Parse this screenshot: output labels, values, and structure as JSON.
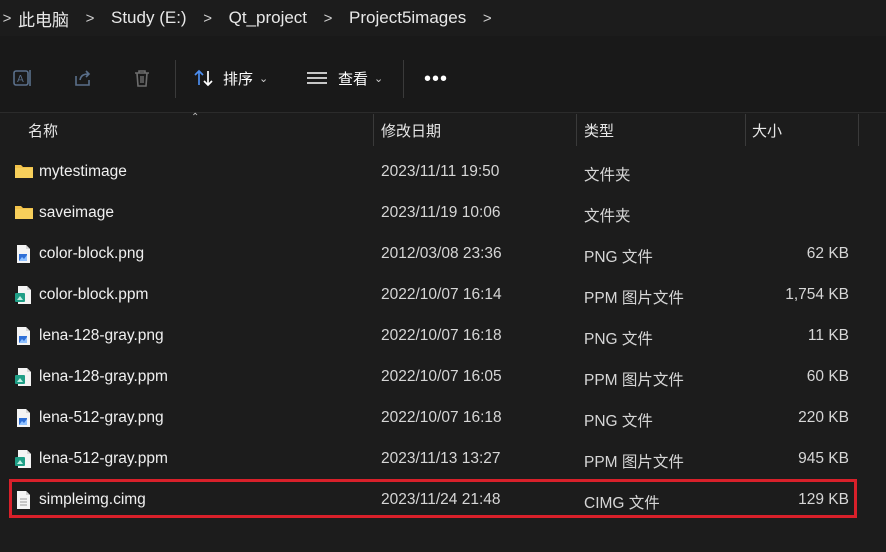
{
  "breadcrumb": [
    "此电脑",
    "Study (E:)",
    "Qt_project",
    "Project5images"
  ],
  "toolbar": {
    "sort_label": "排序",
    "view_label": "查看",
    "more_label": "•••",
    "icons": [
      "rename-icon",
      "share-icon",
      "delete-icon",
      "sort-icon",
      "view-icon",
      "more-icon"
    ]
  },
  "columns": {
    "name": "名称",
    "date": "修改日期",
    "type": "类型",
    "size": "大小"
  },
  "files": [
    {
      "name": "mytestimage",
      "date": "2023/11/11 19:50",
      "type": "文件夹",
      "size": "",
      "icon": "folder-icon"
    },
    {
      "name": "saveimage",
      "date": "2023/11/19 10:06",
      "type": "文件夹",
      "size": "",
      "icon": "folder-icon"
    },
    {
      "name": "color-block.png",
      "date": "2012/03/08 23:36",
      "type": "PNG 文件",
      "size": "62 KB",
      "icon": "png-file-icon"
    },
    {
      "name": "color-block.ppm",
      "date": "2022/10/07 16:14",
      "type": "PPM 图片文件",
      "size": "1,754 KB",
      "icon": "ppm-file-icon"
    },
    {
      "name": "lena-128-gray.png",
      "date": "2022/10/07 16:18",
      "type": "PNG 文件",
      "size": "11 KB",
      "icon": "png-file-icon"
    },
    {
      "name": "lena-128-gray.ppm",
      "date": "2022/10/07 16:05",
      "type": "PPM 图片文件",
      "size": "60 KB",
      "icon": "ppm-file-icon"
    },
    {
      "name": "lena-512-gray.png",
      "date": "2022/10/07 16:18",
      "type": "PNG 文件",
      "size": "220 KB",
      "icon": "png-file-icon"
    },
    {
      "name": "lena-512-gray.ppm",
      "date": "2023/11/13 13:27",
      "type": "PPM 图片文件",
      "size": "945 KB",
      "icon": "ppm-file-icon"
    },
    {
      "name": "simpleimg.cimg",
      "date": "2023/11/24 21:48",
      "type": "CIMG 文件",
      "size": "129 KB",
      "icon": "generic-file-icon",
      "highlighted": true
    }
  ],
  "colors": {
    "background": "#1c1c1c",
    "highlight_border": "#d8202a",
    "folder": "#f2c24a",
    "png_accent": "#2f6fd6",
    "ppm_accent": "#1f9e86"
  }
}
